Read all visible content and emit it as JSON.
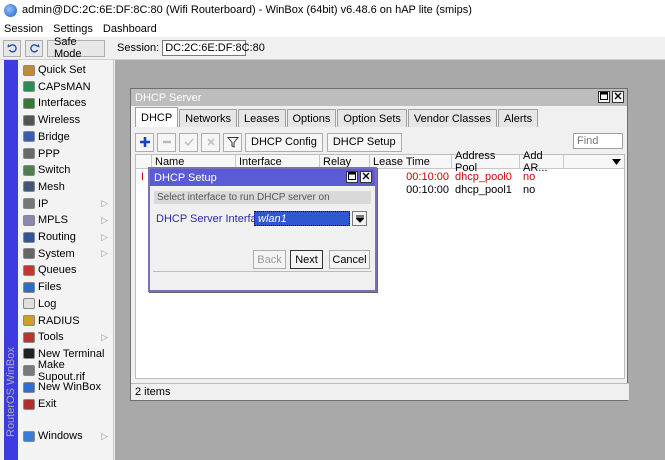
{
  "window_title": "admin@DC:2C:6E:DF:8C:80 (Wifi Routerboard) - WinBox (64bit) v6.48.6 on hAP lite (smips)",
  "menu": [
    "Session",
    "Settings",
    "Dashboard"
  ],
  "toolbar": {
    "undo_icon": "undo-icon",
    "redo_icon": "redo-icon",
    "safe_mode": "Safe Mode",
    "session_label": "Session:",
    "session_value": "DC:2C:6E:DF:8C:80"
  },
  "side_strip_text": "RouterOS WinBox",
  "sidebar": {
    "items": [
      {
        "label": "Quick Set",
        "icon": "wand-icon",
        "color": "#c08a3c",
        "submenu": false
      },
      {
        "label": "CAPsMAN",
        "icon": "capsman-icon",
        "color": "#2e8b57",
        "submenu": false
      },
      {
        "label": "Interfaces",
        "icon": "interfaces-icon",
        "color": "#2e7d32",
        "submenu": false
      },
      {
        "label": "Wireless",
        "icon": "wireless-icon",
        "color": "#555555",
        "submenu": false
      },
      {
        "label": "Bridge",
        "icon": "bridge-icon",
        "color": "#3a5fa8",
        "submenu": false
      },
      {
        "label": "PPP",
        "icon": "ppp-icon",
        "color": "#6a6a6a",
        "submenu": false
      },
      {
        "label": "Switch",
        "icon": "switch-icon",
        "color": "#4f7f4f",
        "submenu": false
      },
      {
        "label": "Mesh",
        "icon": "mesh-icon",
        "color": "#445577",
        "submenu": false
      },
      {
        "label": "IP",
        "icon": "ip-icon",
        "color": "#777777",
        "submenu": true
      },
      {
        "label": "MPLS",
        "icon": "mpls-icon",
        "color": "#8888aa",
        "submenu": true
      },
      {
        "label": "Routing",
        "icon": "routing-icon",
        "color": "#335599",
        "submenu": true
      },
      {
        "label": "System",
        "icon": "system-icon",
        "color": "#666666",
        "submenu": true
      },
      {
        "label": "Queues",
        "icon": "queues-icon",
        "color": "#c0392b",
        "submenu": false
      },
      {
        "label": "Files",
        "icon": "files-icon",
        "color": "#2b6cc4",
        "submenu": false
      },
      {
        "label": "Log",
        "icon": "log-icon",
        "color": "#e0e0e0",
        "submenu": false
      },
      {
        "label": "RADIUS",
        "icon": "radius-icon",
        "color": "#c9a227",
        "submenu": false
      },
      {
        "label": "Tools",
        "icon": "tools-icon",
        "color": "#b33",
        "submenu": true
      },
      {
        "label": "New Terminal",
        "icon": "terminal-icon",
        "color": "#222222",
        "submenu": false
      },
      {
        "label": "Make Supout.rif",
        "icon": "supout-icon",
        "color": "#7a7a7a",
        "submenu": false
      },
      {
        "label": "New WinBox",
        "icon": "winbox-icon",
        "color": "#2f6ed1",
        "submenu": false
      },
      {
        "label": "Exit",
        "icon": "exit-icon",
        "color": "#b03030",
        "submenu": false
      }
    ],
    "windows": {
      "label": "Windows",
      "icon": "windows-icon",
      "color": "#3a7bd5",
      "submenu": true
    }
  },
  "dhcp_server": {
    "title": "DHCP Server",
    "tabs": [
      "DHCP",
      "Networks",
      "Leases",
      "Options",
      "Option Sets",
      "Vendor Classes",
      "Alerts"
    ],
    "active_tab": "DHCP",
    "buttons": {
      "dhcp_config": "DHCP Config",
      "dhcp_setup": "DHCP Setup"
    },
    "find_placeholder": "Find",
    "columns": [
      "Name",
      "Interface",
      "Relay",
      "Lease Time",
      "Address Pool",
      "Add AR..."
    ],
    "rows": [
      {
        "flag": "I",
        "lease_time": "00:10:00",
        "address_pool": "dhcp_pool0",
        "add_arp": "no",
        "invalid": true
      },
      {
        "flag": "",
        "lease_time": "00:10:00",
        "address_pool": "dhcp_pool1",
        "add_arp": "no",
        "invalid": false
      }
    ],
    "status": "2 items"
  },
  "dhcp_setup": {
    "title": "DHCP Setup",
    "hint": "Select interface to run DHCP server on",
    "field_label": "DHCP Server Interface:",
    "field_value": "wlan1",
    "buttons": {
      "back": "Back",
      "next": "Next",
      "cancel": "Cancel"
    }
  },
  "colors": {
    "accent": "#5b5bd6",
    "side_strip": "#3c3ce0",
    "invalid_text": "#d00000"
  }
}
